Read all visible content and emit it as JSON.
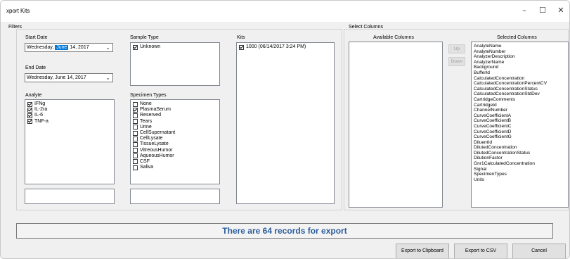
{
  "window": {
    "title": "xport Kits",
    "minimize": "–",
    "maximize": "☐",
    "close": "✕"
  },
  "filters": {
    "group_label": "Filters",
    "start_date_label": "Start Date",
    "start_date": {
      "weekday": "Wednesday,",
      "month": "June",
      "rest": "14, 2017"
    },
    "end_date_label": "End Date",
    "end_date": {
      "weekday": "Wednesday,",
      "month": "June",
      "rest": "14, 2017"
    },
    "sample_type_label": "Sample Type",
    "sample_types": [
      {
        "label": "Unknown",
        "checked": true
      }
    ],
    "kits_label": "Kits",
    "kits": [
      {
        "label": "1000 (06/14/2017 3:24 PM)",
        "checked": true
      }
    ],
    "analyte_label": "Analyte",
    "analytes": [
      {
        "label": "IFNg",
        "checked": true
      },
      {
        "label": "IL-2ra",
        "checked": true
      },
      {
        "label": "IL-6",
        "checked": true
      },
      {
        "label": "TNF-a",
        "checked": true
      }
    ],
    "specimen_types_label": "Specimen Types",
    "specimen_types": [
      {
        "label": "None",
        "checked": false
      },
      {
        "label": "PlasmaSerum",
        "checked": true
      },
      {
        "label": "Reserved",
        "checked": false
      },
      {
        "label": "Tears",
        "checked": false
      },
      {
        "label": "Urine",
        "checked": false
      },
      {
        "label": "CellSupernatant",
        "checked": false
      },
      {
        "label": "CellLysate",
        "checked": false
      },
      {
        "label": "TissueLysate",
        "checked": false
      },
      {
        "label": "VitreousHumor",
        "checked": false
      },
      {
        "label": "AqueousHumor",
        "checked": false
      },
      {
        "label": "CSF",
        "checked": false
      },
      {
        "label": "Saliva",
        "checked": false
      }
    ]
  },
  "select_columns": {
    "group_label": "Select Columns",
    "available_label": "Available Columns",
    "selected_label": "Selected Columns",
    "up_label": "Up",
    "down_label": "Down",
    "selected_columns": [
      "AnalyteName",
      "AnalyteNumber",
      "AnalyzerDescription",
      "AnalyzerName",
      "Background",
      "BufferId",
      "CalculatedConcentration",
      "CalculatedConcentrationPercentCV",
      "CalculatedConcentrationStatus",
      "CalculatedConcentrationStdDev",
      "CartridgeComments",
      "CartridgeId",
      "ChannelNumber",
      "CurveCoefficientA",
      "CurveCoefficientB",
      "CurveCoefficientC",
      "CurveCoefficientD",
      "CurveCoefficientG",
      "DiluentId",
      "DilutedConcentration",
      "DilutedConcentrationStatus",
      "DilutionFactor",
      "Gnr1CalculatedConcentration",
      "Signal",
      "SpecimenTypes",
      "Units"
    ]
  },
  "status_text": "There are 64 records for export",
  "buttons": {
    "clipboard": "Export to Clipboard",
    "csv": "Export to CSV",
    "cancel": "Cancel"
  }
}
